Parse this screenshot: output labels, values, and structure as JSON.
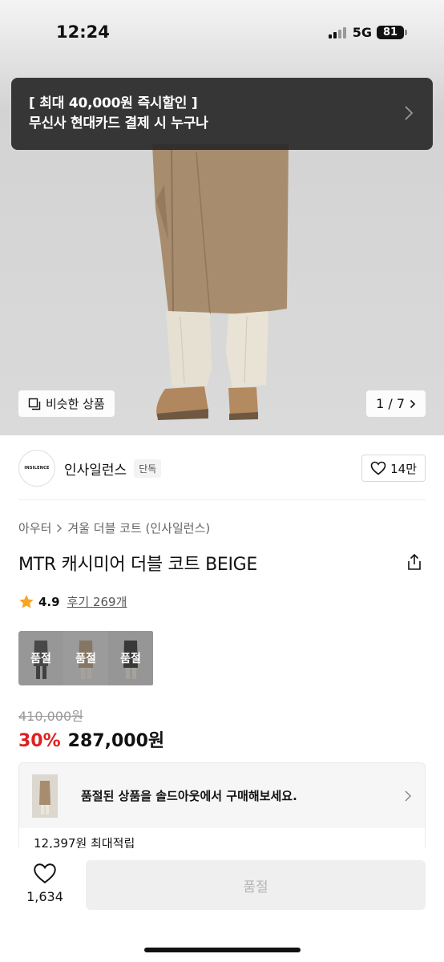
{
  "status_bar": {
    "time": "12:24",
    "network": "5G",
    "battery": "81"
  },
  "promo": {
    "line1": "[ 최대 40,000원 즉시할인 ]",
    "line2": "무신사 현대카드 결제 시 누구나"
  },
  "hero": {
    "similar_label": "비슷한 상품",
    "page_indicator": "1 / 7"
  },
  "brand": {
    "logo_text": "INSILENCE",
    "name": "인사일런스",
    "badge": "단독",
    "like_count": "14만"
  },
  "breadcrumb": {
    "category": "아우터",
    "sub": "겨울 더블 코트 (인사일런스)"
  },
  "product": {
    "title": "MTR 캐시미어 더블 코트 BEIGE",
    "rating": "4.9",
    "reviews": "후기 269개"
  },
  "options": [
    {
      "label": "품절",
      "color": "#3a3a3a"
    },
    {
      "label": "품절",
      "color": "#a98c6c"
    },
    {
      "label": "품절",
      "color": "#1e1e1e"
    }
  ],
  "pricing": {
    "original": "410,000원",
    "discount": "30%",
    "price": "287,000원"
  },
  "soldout": {
    "message": "품절된 상품을 솔드아웃에서 구매해보세요."
  },
  "points": {
    "text": "12,397원 최대적립"
  },
  "bottom": {
    "wish_count": "1,634",
    "buy_label": "품절"
  },
  "colors": {
    "discount": "#e02020",
    "coat": "#a88c6e",
    "pants": "#e9e3d6"
  }
}
